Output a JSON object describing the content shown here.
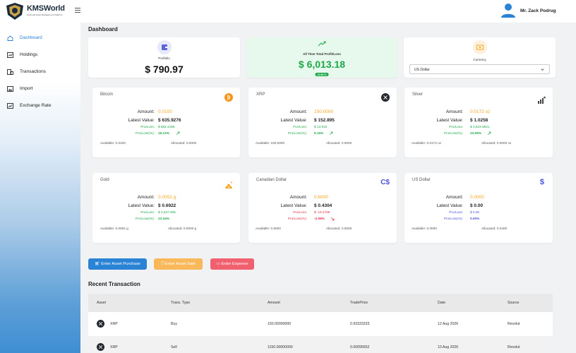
{
  "header": {
    "logo_text": "KMSWorld",
    "logo_sub": "Personal Asset Management Platform",
    "user_name": "Mr. Zack Podrug"
  },
  "sidebar": {
    "items": [
      {
        "label": "Dashboard",
        "icon": "home-icon",
        "active": true
      },
      {
        "label": "Holdings",
        "icon": "chart-box-icon"
      },
      {
        "label": "Transactions",
        "icon": "transactions-icon"
      },
      {
        "label": "Import",
        "icon": "image-icon"
      },
      {
        "label": "Exchange Rate",
        "icon": "trend-box-icon"
      }
    ]
  },
  "main": {
    "title": "Dashboard",
    "summary": {
      "portfolio": {
        "label": "Portfolio",
        "value": "$ 790.97",
        "icon": "wallet-icon"
      },
      "profit": {
        "label": "All Time Total Profit/Loss",
        "value": "$ 6,013.18",
        "pct": "12.62 %",
        "icon": "trend-up-icon"
      },
      "currency": {
        "label": "Currency",
        "selected": "US Dollar",
        "icon": "cash-icon"
      }
    },
    "labels": {
      "amount": "Amount:",
      "latest": "Latest Value:",
      "pl": "Pro/Loss:",
      "plpct": "Pro/Loss(%):"
    },
    "assets": [
      {
        "name": "Bitcoin",
        "icon": "bitcoin-icon",
        "amount": "0.0100",
        "latest": "$ 635.9276",
        "pl": "$ 882.4185",
        "plpct": "16.13%",
        "available": "Available: 0.0100",
        "allocated": "Allocated: 0.0000"
      },
      {
        "name": "XRP",
        "icon": "xrp-icon",
        "amount": "150.0000",
        "latest": "$ 152.895",
        "pl": "$ 12.915",
        "plpct": "9.15%",
        "available": "Available: 150.0000",
        "allocated": "Allocated: 0.0000"
      },
      {
        "name": "Silver",
        "icon": "silver-icon",
        "amount": "0.0172 oz",
        "latest": "$ 1.0258",
        "pl": "$ 3,519.0831",
        "plpct": "23.09%",
        "available": "Available: 0.0172 oz",
        "allocated": "Allocated: 0.0000 oz"
      },
      {
        "name": "Gold",
        "icon": "gold-bars-icon",
        "amount": "0.0052 g",
        "latest": "$ 0.6922",
        "pl": "$ 3,637.005",
        "plpct": "23.34%",
        "available": "Available: 0.0052 g",
        "allocated": "Allocated: 0.0000 g"
      },
      {
        "name": "Canadian Dollar",
        "icon": "cad-icon",
        "icon_text": "C$",
        "amount": "0.6000",
        "latest": "$ 0.4304",
        "pl": "$ -18.2769",
        "plpct": "-2.09%",
        "available": "Available: 0.6000",
        "allocated": "Allocated: 0.0000"
      },
      {
        "name": "US Dollar",
        "icon": "usd-icon",
        "icon_text": "$",
        "amount": "0.0000",
        "latest": "$ 0.00",
        "pl": "$ 0.00",
        "plpct": "0.00%",
        "available": "Available: 0.0000",
        "allocated": "Allocated: 0.0400"
      }
    ],
    "buttons": {
      "purchase": "Enter Asset Purchase",
      "sale": "Enter Asset Sale",
      "expense": "Enter Expense"
    },
    "recent_title": "Recent Transaction",
    "table": {
      "headers": [
        "Asset",
        "Trans. Type",
        "Amount",
        "TradePrice",
        "Date",
        "Source"
      ],
      "rows": [
        [
          "XRP",
          "Buy",
          "150.00000000",
          "0.93333333",
          "12 Aug 2026",
          "Revolut"
        ],
        [
          "XRP",
          "Sell",
          "1150.00000000",
          "0.00095652",
          "10 Aug 2026",
          "Revolut"
        ]
      ]
    },
    "colors": {
      "accent": "#2b83d6",
      "amount_orange": "#f5a623",
      "profit_green": "#1ea84a",
      "loss_red": "#e0304a",
      "neutral_blue": "#4a55d6"
    }
  }
}
